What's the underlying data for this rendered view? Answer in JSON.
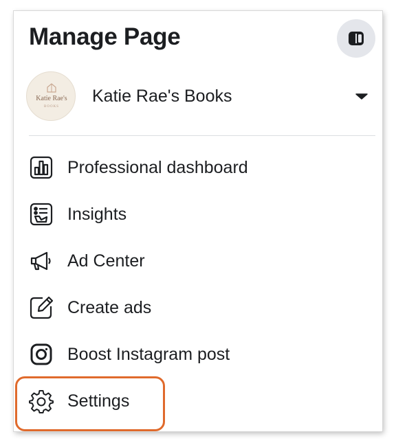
{
  "header": {
    "title": "Manage Page",
    "toggle_icon": "panel-toggle-icon"
  },
  "profile": {
    "name": "Katie Rae's Books",
    "avatar_text": "Katie Rae's",
    "avatar_subtext": "BOOKS",
    "dropdown_icon": "caret-down-icon"
  },
  "menu": {
    "items": [
      {
        "label": "Professional dashboard",
        "icon": "dashboard-icon"
      },
      {
        "label": "Insights",
        "icon": "insights-icon"
      },
      {
        "label": "Ad Center",
        "icon": "megaphone-icon"
      },
      {
        "label": "Create ads",
        "icon": "pencil-square-icon"
      },
      {
        "label": "Boost Instagram post",
        "icon": "instagram-icon"
      },
      {
        "label": "Settings",
        "icon": "gear-icon"
      }
    ]
  },
  "colors": {
    "highlight": "#e06a2c",
    "toggle_bg": "#e4e6eb",
    "text": "#1c1e21"
  }
}
